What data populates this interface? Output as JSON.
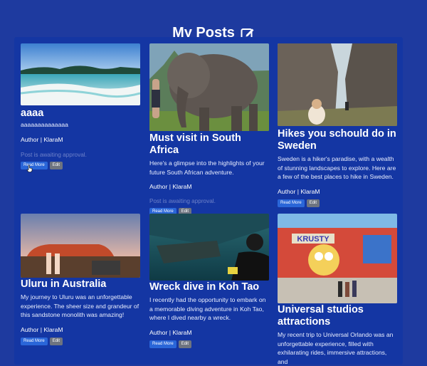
{
  "page": {
    "title": "My Posts"
  },
  "posts": [
    {
      "title": "aaaa",
      "excerpt": "aaaaaaaaaaaaaa",
      "author": "Author | KlaraM",
      "status": "Post is awaiting approval.",
      "read_more_label": "Read More",
      "edit_label": "Edit",
      "image": "beach-lagoon-image"
    },
    {
      "title": "Must visit in South Africa",
      "excerpt": "Here's a glimpse into the highlights of your future South African adventure.",
      "author": "Author | KlaraM",
      "status": "Post is awaiting approval.",
      "read_more_label": "Read More",
      "edit_label": "Edit",
      "image": "elephant-image"
    },
    {
      "title": "Hikes you schould do in Sweden",
      "excerpt": "Sweden is a hiker's paradise, with a wealth of stunning landscapes to explore. Here are a few of the best places to hike in Sweden.",
      "author": "Author | KlaraM",
      "read_more_label": "Read More",
      "edit_label": "Edit",
      "image": "rock-canyon-image"
    },
    {
      "title": "Uluru in Australia",
      "excerpt": "My journey to Uluru was an unforgettable experience. The sheer size and grandeur of this sandstone monolith was amazing!",
      "author": "Author | KlaraM",
      "read_more_label": "Read More",
      "edit_label": "Edit",
      "image": "uluru-image"
    },
    {
      "title": "Wreck dive in Koh Tao",
      "excerpt": "I recently had the opportunity to embark on a memorable diving adventure in Koh Tao, where I dived nearby a wreck.",
      "author": "Author | KlaraM",
      "read_more_label": "Read More",
      "edit_label": "Edit",
      "image": "wreck-dive-image"
    },
    {
      "title": "Universal studios attractions",
      "excerpt": "My recent trip to Universal Orlando was an unforgettable experience, filled with exhilarating rides, immersive attractions, and",
      "image": "krusty-land-image",
      "sign_text": "KRUSTY"
    }
  ],
  "colors": {
    "background": "#1e3a9f",
    "panel": "#1436a3",
    "read_more": "#2a66d8",
    "edit": "#6e7480",
    "approval_text": "#6f82c9"
  }
}
